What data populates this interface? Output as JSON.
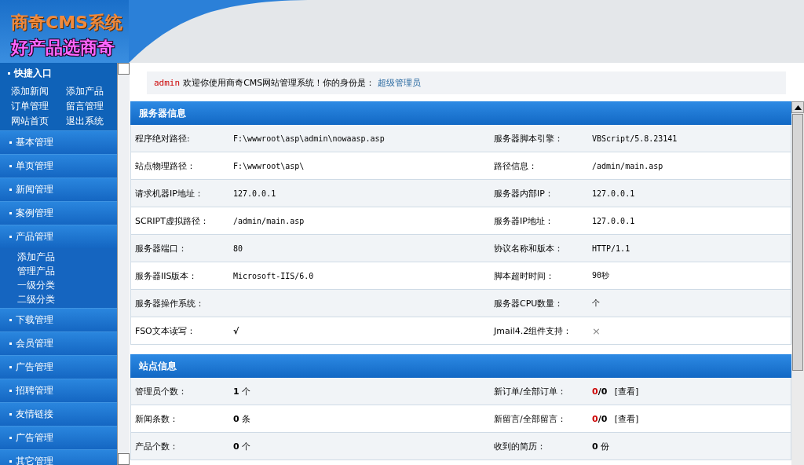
{
  "logo": {
    "title": "商奇CMS系统",
    "slogan": "好产品选商奇"
  },
  "sidebar": {
    "quick": {
      "title": "快捷入口",
      "links": [
        "添加新闻",
        "添加产品",
        "订单管理",
        "留言管理",
        "网站首页",
        "退出系统"
      ]
    },
    "menu": [
      {
        "label": "基本管理"
      },
      {
        "label": "单页管理"
      },
      {
        "label": "新闻管理"
      },
      {
        "label": "案例管理"
      },
      {
        "label": "产品管理",
        "children": [
          "添加产品",
          "管理产品",
          "一级分类",
          "二级分类"
        ]
      },
      {
        "label": "下载管理"
      },
      {
        "label": "会员管理"
      },
      {
        "label": "广告管理"
      },
      {
        "label": "招聘管理"
      },
      {
        "label": "友情链接"
      },
      {
        "label": "广告管理"
      },
      {
        "label": "其它管理"
      }
    ]
  },
  "welcome": {
    "user": "admin",
    "text": "欢迎你使用商奇CMS网站管理系统！你的身份是：",
    "role": "超级管理员"
  },
  "server_info": {
    "title": "服务器信息",
    "rows": [
      [
        {
          "label": "程序绝对路径:",
          "value": "F:\\wwwroot\\asp\\admin\\nowaasp.asp"
        },
        {
          "label": "服务器脚本引擎：",
          "value": "VBScript/5.8.23141"
        }
      ],
      [
        {
          "label": "站点物理路径：",
          "value": "F:\\wwwroot\\asp\\"
        },
        {
          "label": "路径信息：",
          "value": "/admin/main.asp"
        }
      ],
      [
        {
          "label": "请求机器IP地址：",
          "value": "127.0.0.1"
        },
        {
          "label": "服务器内部IP：",
          "value": "127.0.0.1"
        }
      ],
      [
        {
          "label": "SCRIPT虚拟路径：",
          "value": "/admin/main.asp"
        },
        {
          "label": "服务器IP地址：",
          "value": "127.0.0.1"
        }
      ],
      [
        {
          "label": "服务器端口：",
          "value": "80"
        },
        {
          "label": "协议名称和版本：",
          "value": "HTTP/1.1"
        }
      ],
      [
        {
          "label": "服务器IIS版本：",
          "value": "Microsoft-IIS/6.0"
        },
        {
          "label": "脚本超时时间：",
          "value": "90秒"
        }
      ],
      [
        {
          "label": "服务器操作系统："
        },
        {
          "label": "服务器CPU数量：",
          "value": "个"
        }
      ],
      [
        {
          "label": "FSO文本读写：",
          "value": "√",
          "kind": "yes"
        },
        {
          "label": "Jmail4.2组件支持：",
          "value": "×",
          "kind": "no"
        }
      ]
    ]
  },
  "site_info": {
    "title": "站点信息",
    "rows": [
      [
        {
          "label": "管理员个数：",
          "kind": "count",
          "value": "**1** 个"
        },
        {
          "label": "新订单/全部订单：",
          "kind": "ratio",
          "new": "0",
          "total": "/0",
          "link": "[查看]"
        }
      ],
      [
        {
          "label": "新闻条数：",
          "kind": "count",
          "value": "**0** 条"
        },
        {
          "label": "新留言/全部留言：",
          "kind": "ratio",
          "new": "0",
          "total": "/0",
          "link": "[查看]"
        }
      ],
      [
        {
          "label": "产品个数：",
          "kind": "count",
          "value": "**0** 个"
        },
        {
          "label": "收到的简历：",
          "kind": "count",
          "value": "**0** 份"
        }
      ]
    ]
  }
}
